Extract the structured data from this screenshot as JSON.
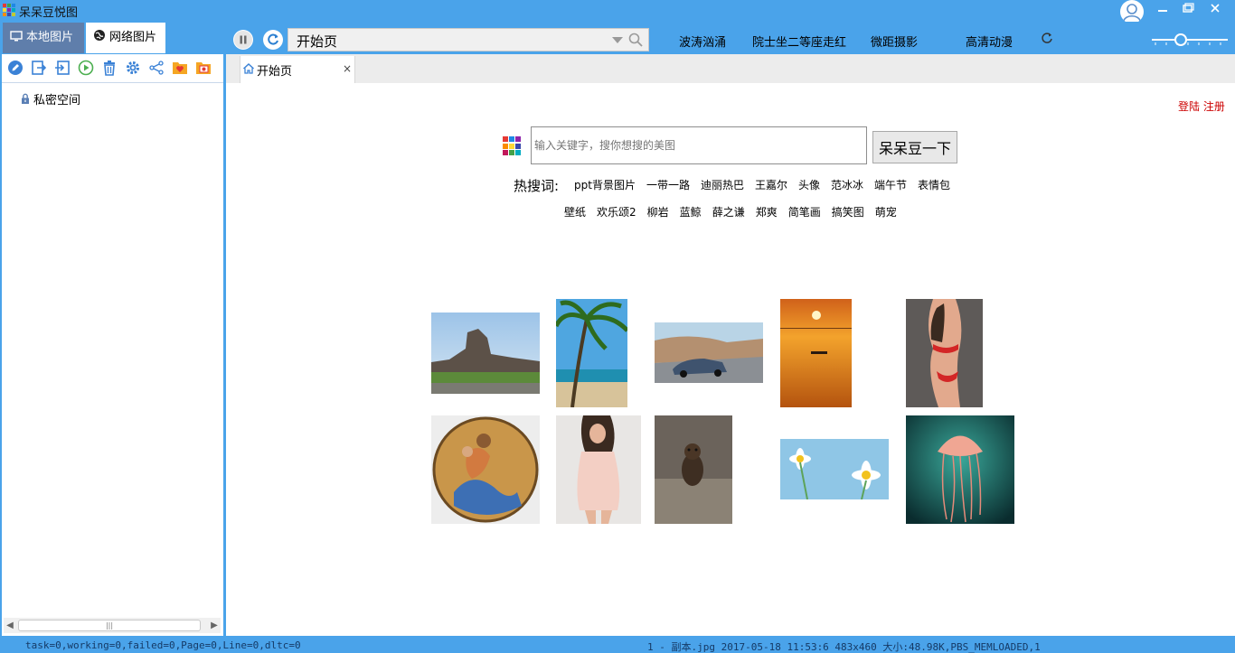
{
  "window": {
    "title": "呆呆豆悦图",
    "controls": [
      "minimize",
      "restore",
      "close"
    ]
  },
  "sidebar": {
    "tabs": [
      {
        "label": "本地图片",
        "active": false
      },
      {
        "label": "网络图片",
        "active": true
      }
    ],
    "toolbar_icons": [
      "edit-icon",
      "export-icon",
      "import-icon",
      "play-icon",
      "trash-icon",
      "settings-icon",
      "share-icon",
      "favorite-folder-icon",
      "photo-folder-icon"
    ],
    "tree": [
      {
        "label": "私密空间",
        "icon": "lock-icon"
      }
    ]
  },
  "toolbar": {
    "address": "开始页",
    "nav_links": [
      "波涛汹涌",
      "院士坐二等座走红",
      "微距摄影",
      "高清动漫"
    ]
  },
  "tabs": [
    {
      "label": "开始页",
      "close": "×"
    }
  ],
  "start_page": {
    "login": "登陆 注册",
    "search_placeholder": "输入关键字，搜你想搜的美图",
    "search_button": "呆呆豆一下",
    "hot_label": "热搜词:",
    "hot_row1": [
      "ppt背景图片",
      "一带一路",
      "迪丽热巴",
      "王嘉尔",
      "头像",
      "范冰冰",
      "端午节",
      "表情包"
    ],
    "hot_row2": [
      "壁纸",
      "欢乐颂2",
      "柳岩",
      "蓝鲸",
      "薛之谦",
      "郑爽",
      "简笔画",
      "搞笑图",
      "萌宠"
    ],
    "thumbnails": [
      {
        "name": "sphinx-rock-landscape"
      },
      {
        "name": "palm-tree-beach"
      },
      {
        "name": "sports-car-coast"
      },
      {
        "name": "sunset-sea-boat"
      },
      {
        "name": "woman-red-bikini"
      },
      {
        "name": "round-painting"
      },
      {
        "name": "woman-pink-lingerie"
      },
      {
        "name": "small-animal-rock"
      },
      {
        "name": "daisies-blue-sky"
      },
      {
        "name": "jellyfish"
      }
    ]
  },
  "status": {
    "left": "task=0,working=0,failed=0,Page=0,Line=0,dltc=0",
    "right": "1 - 副本.jpg  2017-05-18 11:53:6  483x460  大小:48.98K,PBS_MEMLOADED,1"
  },
  "colors": {
    "accent": "#4aa3ea",
    "sidebar_tab_active": "#5f7eab",
    "login_red": "#cc0000"
  }
}
